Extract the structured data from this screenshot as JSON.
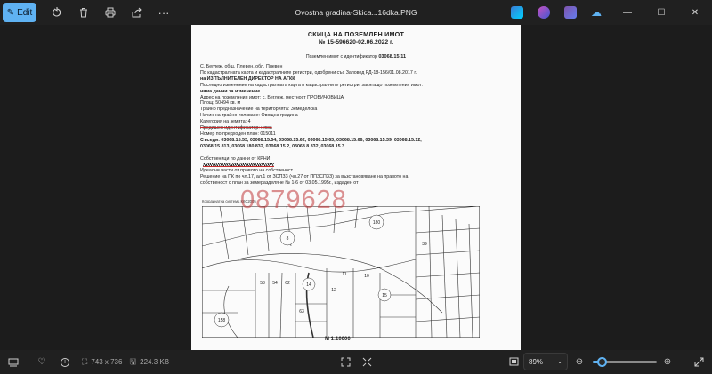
{
  "window": {
    "title": "Ovostna gradina-Skica...16dka.PNG"
  },
  "toolbar": {
    "edit_label": "Edit",
    "icons": [
      "pen-icon",
      "rotate-icon",
      "delete-icon",
      "print-icon",
      "share-icon",
      "more-icon"
    ]
  },
  "document": {
    "heading1": "СКИЦА НА ПОЗЕМЛЕН ИМОТ",
    "heading2": "№ 15-596620-02.06.2022 г.",
    "ident_prefix": "Поземлен имот с  идентификатор",
    "ident_value": "03068.15.11",
    "lines": [
      "С. Беглеж, общ. Плевен, обл. Плевен",
      "По кадастралната карта и кадастралните регистри, одобрени със Заповед РД-18-156/01.08.2017 г.",
      "на ИЗПЪЛНИТЕЛЕН ДИРЕКТОР НА АГКК",
      "Последно изменение на кадастралната карта и кадастралните регистри, засягащо поземления имот:",
      "няма данни за изменение",
      "Адрес на поземления имот: с. Беглеж, местност ПРОБИЧОВИЦА",
      "Площ: 50494 кв. м",
      "Трайно предназначение на територията: Земеделска",
      "Начин на трайно ползване: Овощна градина",
      "Категория на земята: 4",
      "Предишен идентификатор: няма",
      "Номер по предходен план: 015011",
      "Съседи: 03068.15.53, 03068.15.54, 03068.15.62, 03068.15.63, 03068.15.66, 03068.15.39, 03068.15.12,",
      "03068.15.813, 03068.180.832, 03068.15.2, 03068.8.832, 03068.15.3",
      "",
      "Собственици по данни от КРНИ:",
      "",
      "Идеални части от правото на собственост",
      "Решение на ПК по чл.17, ал.1 от ЗСПЗЗ (чл.27 от ППЗСПЗЗ) за възстановяване на правото на",
      "собственост с план за земеразделяне № 1-6 от 03.05.1995г., издаден от"
    ],
    "map_caption": "Координатна система ККС2005",
    "scale": "М 1:10000",
    "watermark": "0879628",
    "parcel_labels": [
      "180",
      "8",
      "14",
      "15",
      "11",
      "10",
      "12",
      "158",
      "53",
      "54",
      "62",
      "63",
      "39"
    ]
  },
  "status": {
    "dimensions": "743 x 736",
    "filesize": "224.3 KB",
    "zoom": "89%",
    "zoom_fraction": 0.14
  },
  "colors": {
    "accent": "#5fb2f2",
    "background": "#202020",
    "watermark": "#c0393b"
  }
}
